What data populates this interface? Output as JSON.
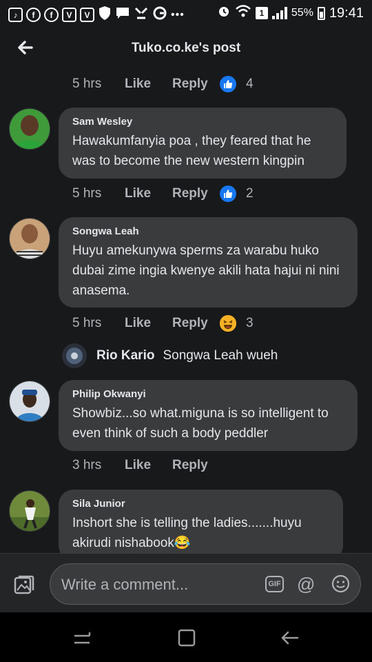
{
  "status_bar": {
    "battery": "55%",
    "time": "19:41",
    "sim_badge": "1",
    "left_icons": [
      "tiktok-icon",
      "facebook-icon",
      "facebook-icon",
      "vivaldi-icon",
      "vivaldi-icon",
      "shield-icon",
      "chat-icon",
      "cursor-icon",
      "opera-icon",
      "more-icon"
    ],
    "v_label": "V"
  },
  "header": {
    "title": "Tuko.co.ke's post"
  },
  "actions": {
    "like": "Like",
    "reply": "Reply"
  },
  "top_meta": {
    "time": "5 hrs",
    "reaction_count": "4"
  },
  "comments": [
    {
      "author": "Sam Wesley",
      "text": "Hawakumfanyia poa , they feared that he was to become the new western kingpin",
      "time": "5 hrs",
      "reaction_count": "2",
      "reaction": "like"
    },
    {
      "author": "Songwa Leah",
      "text": "Huyu amekunywa sperms za warabu huko dubai zime ingia kwenye akili hata hajui ni nini anasema.",
      "time": "5 hrs",
      "reaction_count": "3",
      "reaction": "haha"
    },
    {
      "author": "Philip Okwanyi",
      "text": "Showbiz...so what.miguna is so intelligent to even think of such a body peddler",
      "time": "3 hrs"
    },
    {
      "author": "Sila Junior",
      "text": "Inshort she is telling the ladies.......huyu akirudi nishabook😂"
    }
  ],
  "reply_preview": {
    "author": "Rio Kario",
    "text": "Songwa Leah wueh"
  },
  "composer": {
    "placeholder": "Write a comment...",
    "gif_label": "GIF",
    "at_label": "@"
  },
  "colors": {
    "background": "#18191a",
    "bubble": "#3a3b3c",
    "accent": "#1877f2",
    "haha": "#f7b125"
  }
}
